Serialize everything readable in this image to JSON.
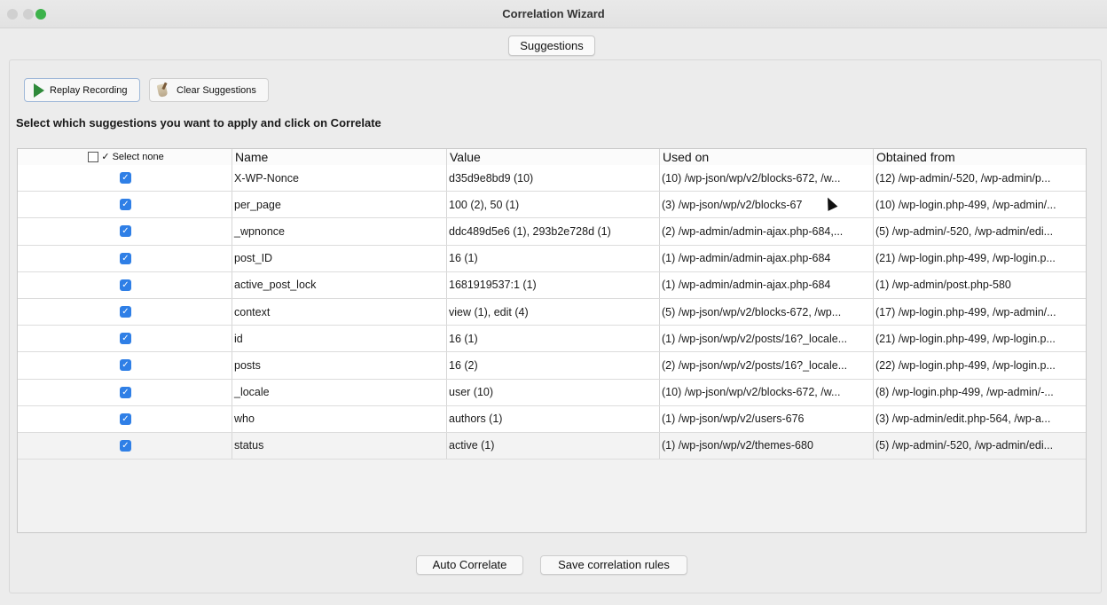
{
  "window": {
    "title": "Correlation Wizard"
  },
  "tabs": [
    {
      "label": "Suggestions"
    }
  ],
  "toolbar": {
    "replay_label": "Replay Recording",
    "clear_label": "Clear Suggestions"
  },
  "instruction": "Select which suggestions you want to apply and click on Correlate",
  "table": {
    "select_toggle": "✓ Select none",
    "columns": [
      "Name",
      "Value",
      "Used on",
      "Obtained from"
    ],
    "rows": [
      {
        "checked": true,
        "name": "X-WP-Nonce",
        "value": "d35d9e8bd9 (10)",
        "used_on": "(10) /wp-json/wp/v2/blocks-672, /w...",
        "obtained_from": "(12) /wp-admin/-520, /wp-admin/p..."
      },
      {
        "checked": true,
        "name": "per_page",
        "value": "100 (2), 50 (1)",
        "used_on": "(3) /wp-json/wp/v2/blocks-67",
        "obtained_from": "(10) /wp-login.php-499, /wp-admin/..."
      },
      {
        "checked": true,
        "name": "_wpnonce",
        "value": "ddc489d5e6 (1), 293b2e728d (1)",
        "used_on": "(2) /wp-admin/admin-ajax.php-684,...",
        "obtained_from": "(5) /wp-admin/-520, /wp-admin/edi..."
      },
      {
        "checked": true,
        "name": "post_ID",
        "value": "16 (1)",
        "used_on": "(1) /wp-admin/admin-ajax.php-684",
        "obtained_from": "(21) /wp-login.php-499, /wp-login.p..."
      },
      {
        "checked": true,
        "name": "active_post_lock",
        "value": "1681919537:1 (1)",
        "used_on": "(1) /wp-admin/admin-ajax.php-684",
        "obtained_from": "(1) /wp-admin/post.php-580"
      },
      {
        "checked": true,
        "name": "context",
        "value": "view (1), edit (4)",
        "used_on": "(5) /wp-json/wp/v2/blocks-672, /wp...",
        "obtained_from": "(17) /wp-login.php-499, /wp-admin/..."
      },
      {
        "checked": true,
        "name": "id",
        "value": "16 (1)",
        "used_on": "(1) /wp-json/wp/v2/posts/16?_locale...",
        "obtained_from": "(21) /wp-login.php-499, /wp-login.p..."
      },
      {
        "checked": true,
        "name": "posts",
        "value": "16 (2)",
        "used_on": "(2) /wp-json/wp/v2/posts/16?_locale...",
        "obtained_from": "(22) /wp-login.php-499, /wp-login.p..."
      },
      {
        "checked": true,
        "name": "_locale",
        "value": "user (10)",
        "used_on": "(10) /wp-json/wp/v2/blocks-672, /w...",
        "obtained_from": "(8) /wp-login.php-499, /wp-admin/-..."
      },
      {
        "checked": true,
        "name": "who",
        "value": "authors (1)",
        "used_on": "(1) /wp-json/wp/v2/users-676",
        "obtained_from": "(3) /wp-admin/edit.php-564, /wp-a..."
      },
      {
        "checked": true,
        "name": "status",
        "value": "active (1)",
        "used_on": "(1) /wp-json/wp/v2/themes-680",
        "obtained_from": "(5) /wp-admin/-520, /wp-admin/edi..."
      }
    ]
  },
  "footer": {
    "auto_correlate_label": "Auto Correlate",
    "save_rules_label": "Save correlation rules"
  },
  "colors": {
    "checkbox": "#2f7fe6",
    "play_icon": "#2f8a3a",
    "maximize": "#3cb24a"
  }
}
